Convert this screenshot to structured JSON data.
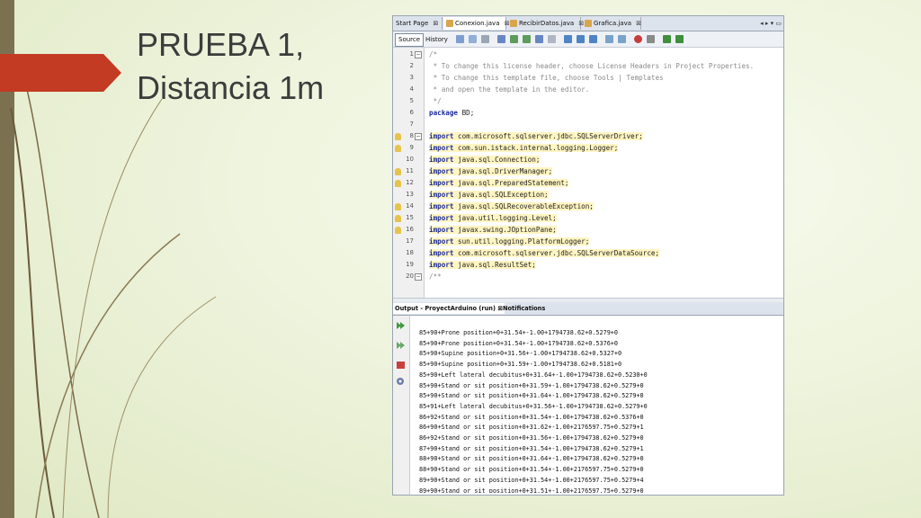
{
  "slide": {
    "title_line1": "PRUEBA 1,",
    "title_line2": "Distancia 1m"
  },
  "editor": {
    "tabs": [
      {
        "label": "Start Page"
      },
      {
        "label": "Conexion.java"
      },
      {
        "label": "RecibirDatos.java"
      },
      {
        "label": "Grafica.java"
      }
    ],
    "toolbar": {
      "source_label": "Source",
      "history_label": "History"
    },
    "code_lines": [
      {
        "num": "1",
        "text": "/*"
      },
      {
        "num": "2",
        "text": " * To change this license header, choose License Headers in Project Properties."
      },
      {
        "num": "3",
        "text": " * To change this template file, choose Tools | Templates"
      },
      {
        "num": "4",
        "text": " * and open the template in the editor."
      },
      {
        "num": "5",
        "text": " */"
      },
      {
        "num": "6",
        "text": "package BD;"
      },
      {
        "num": "7",
        "text": ""
      },
      {
        "num": "8",
        "text": "import com.microsoft.sqlserver.jdbc.SQLServerDriver;"
      },
      {
        "num": "9",
        "text": "import com.sun.istack.internal.logging.Logger;"
      },
      {
        "num": "10",
        "text": "import java.sql.Connection;"
      },
      {
        "num": "11",
        "text": "import java.sql.DriverManager;"
      },
      {
        "num": "12",
        "text": "import java.sql.PreparedStatement;"
      },
      {
        "num": "13",
        "text": "import java.sql.SQLException;"
      },
      {
        "num": "14",
        "text": "import java.sql.SQLRecoverableException;"
      },
      {
        "num": "15",
        "text": "import java.util.logging.Level;"
      },
      {
        "num": "16",
        "text": "import javax.swing.JOptionPane;"
      },
      {
        "num": "17",
        "text": "import sun.util.logging.PlatformLogger;"
      },
      {
        "num": "18",
        "text": "import com.microsoft.sqlserver.jdbc.SQLServerDataSource;"
      },
      {
        "num": "19",
        "text": "import java.sql.ResultSet;"
      },
      {
        "num": "20",
        "text": "/**"
      }
    ]
  },
  "output": {
    "tab_output_label": "Output - ProyectArduino (run)",
    "tab_notifications_label": "Notifications",
    "lines": [
      "85+90+Prone position+0+31.54+-1.00+1794738.62+0.5279+0",
      "85+90+Prone position+0+31.54+-1.00+1794738.62+0.5376+0",
      "85+90+Supine position+0+31.56+-1.00+1794738.62+0.5327+0",
      "85+90+Supine position+0+31.59+-1.00+1794738.62+0.5181+0",
      "85+90+Left lateral decubitus+0+31.64+-1.00+1794738.62+0.5230+0",
      "85+90+Stand or sit position+0+31.59+-1.00+1794738.62+0.5279+0",
      "85+90+Stand or sit position+0+31.64+-1.00+1794738.62+0.5279+0",
      "85+91+Left lateral decubitus+0+31.56+-1.00+1794738.62+0.5279+0",
      "86+92+Stand or sit position+0+31.54+-1.00+1794738.62+0.5376+0",
      "86+90+Stand or sit position+0+31.62+-1.00+2176597.75+0.5279+1",
      "86+92+Stand or sit position+0+31.56+-1.00+1794738.62+0.5279+0",
      "87+90+Stand or sit position+0+31.54+-1.00+1794738.62+0.5279+1",
      "88+90+Stand or sit position+0+31.64+-1.00+1794738.62+0.5279+0",
      "88+90+Stand or sit position+0+31.54+-1.00+2176597.75+0.5279+0",
      "89+90+Stand or sit position+0+31.54+-1.00+2176597.75+0.5279+4",
      "89+90+Stand or sit position+0+31.51+-1.00+2176597.75+0.5279+0"
    ]
  }
}
